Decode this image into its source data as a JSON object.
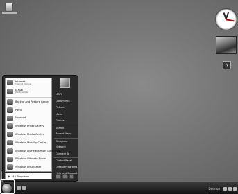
{
  "start_menu": {
    "pinned": [
      {
        "name": "Internet",
        "sub": "Internet Explorer"
      },
      {
        "name": "E-mail",
        "sub": "Windows Mail"
      }
    ],
    "recent": [
      "Backup and Restore Center",
      "Paint",
      "Notepad",
      "Windows Photo Gallery",
      "Windows Media Center",
      "Windows Mobility Center",
      "Windows Live Messenger Download",
      "Windows Ultimate Extras",
      "Windows DVD Maker"
    ],
    "all_programs": "All Programs",
    "right_items": [
      "MDPI",
      "Documents",
      "Pictures",
      "Music",
      "Games",
      "Search",
      "Recent Items",
      "Computer",
      "Network",
      "Connect To",
      "Control Panel",
      "Default Programs",
      "Help and Support"
    ]
  },
  "taskbar": {
    "language": "Desktop",
    "time": ""
  },
  "sidebar": {
    "feed_icon_label": "N"
  }
}
